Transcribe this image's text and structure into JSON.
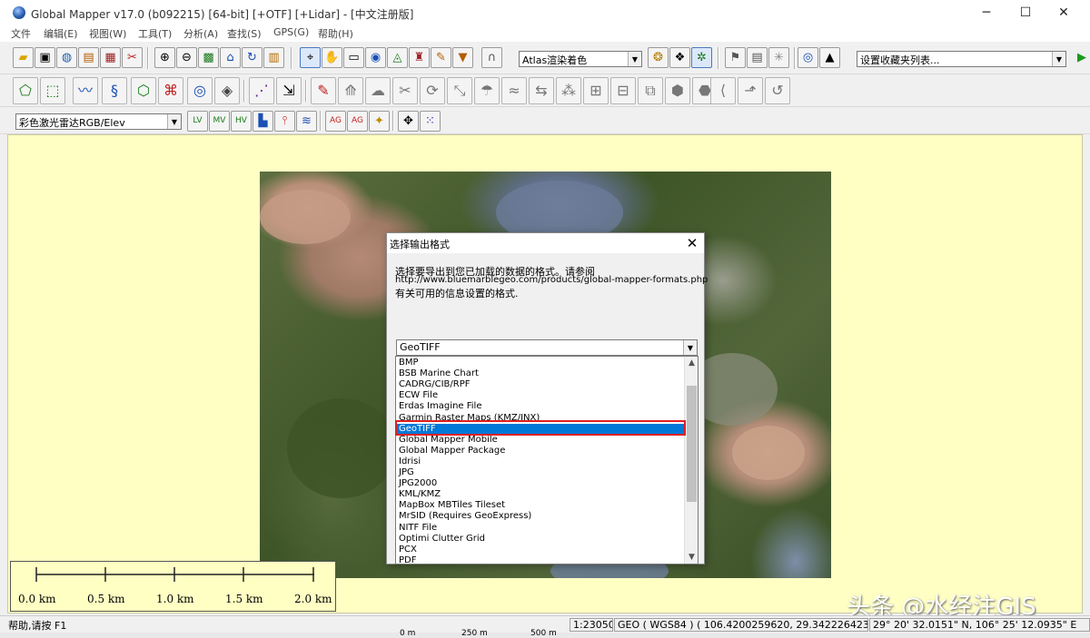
{
  "window": {
    "title": "Global Mapper v17.0 (b092215) [64-bit] [+OTF] [+Lidar] - [中文注册版]",
    "minimize": "─",
    "maximize": "☐",
    "close": "✕"
  },
  "menu": [
    "文件",
    "编辑(E)",
    "视图(W)",
    "工具(T)",
    "分析(A)",
    "查找(S)",
    "GPS(G)",
    "帮助(H)"
  ],
  "toolbar": {
    "shader_combo": "Atlas渲染着色",
    "favorites_combo": "设置收藏夹列表...",
    "layer_combo": "彩色激光雷达RGB/Elev"
  },
  "dialog": {
    "title": "选择输出格式",
    "close": "✕",
    "desc_line1": "选择要导出到您已加载的数据的格式。请参阅",
    "desc_line2": "http://www.bluemarblegeo.com/products/global-mapper-formats.php",
    "desc_line3": "有关可用的信息设置的格式.",
    "selected": "GeoTIFF",
    "options": [
      "BMP",
      "BSB Marine Chart",
      "CADRG/CIB/RPF",
      "ECW File",
      "Erdas Imagine File",
      "Garmin Raster Maps (KMZ/JNX)",
      "GeoTIFF",
      "Global Mapper Mobile",
      "Global Mapper Package",
      "Idrisi",
      "JPG",
      "JPG2000",
      "KML/KMZ",
      "MapBox MBTiles Tileset",
      "MrSID (Requires GeoExpress)",
      "NITF File",
      "Optimi Clutter Grid",
      "PCX",
      "PDF"
    ],
    "selected_index": 6
  },
  "scale_bar": {
    "labels": [
      "0.0 km",
      "0.5 km",
      "1.0 km",
      "1.5 km",
      "2.0 km"
    ]
  },
  "status": {
    "help": "帮助,请按 F1",
    "scale": "1:23050",
    "coords": "GEO ( WGS84 ) ( 106.4200259620, 29.3422264234 )",
    "dms": "29° 20' 32.0151\" N, 106° 25' 12.0935\" E"
  },
  "bottom_ruler": [
    "0 m",
    "250 m",
    "500 m"
  ],
  "watermark": "头条 @水经注GIS"
}
